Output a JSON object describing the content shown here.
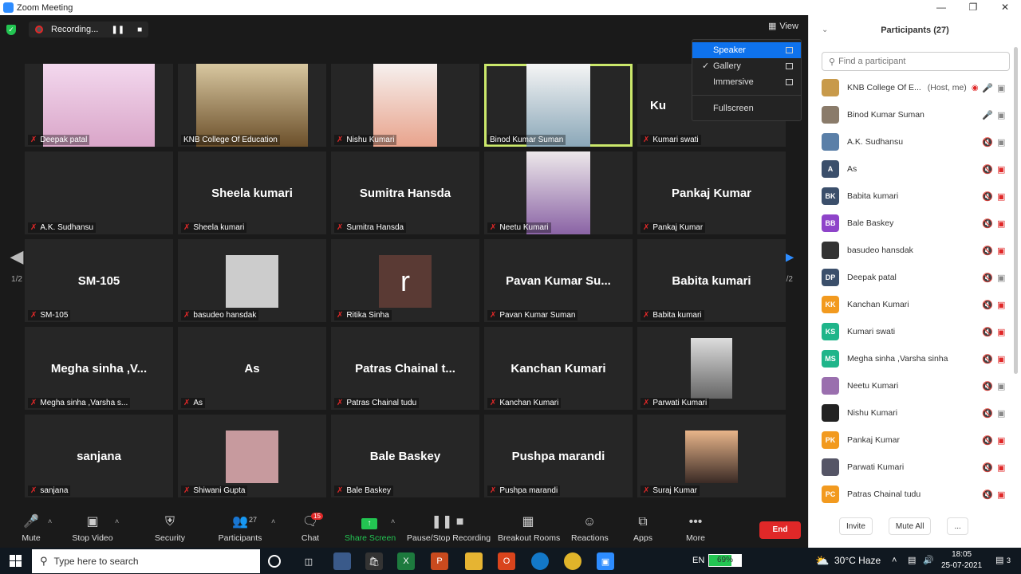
{
  "window": {
    "title": "Zoom Meeting"
  },
  "recording": {
    "label": "Recording..."
  },
  "view_button": {
    "label": "View"
  },
  "view_menu": {
    "items": [
      {
        "label": "Speaker",
        "active": true
      },
      {
        "label": "Gallery",
        "checked": true
      },
      {
        "label": "Immersive"
      },
      {
        "label": "Fullscreen"
      }
    ]
  },
  "gallery": {
    "page_left": "1/2",
    "page_right": "1/2",
    "tiles": [
      {
        "label": "Deepak patal"
      },
      {
        "label": "KNB College Of Education"
      },
      {
        "label": "Nishu Kumari"
      },
      {
        "label": "Binod Kumar Suman",
        "speaking": true
      },
      {
        "label": "Kumari swati",
        "big": "Ku"
      },
      {
        "label": "A.K. Sudhansu"
      },
      {
        "label": "Sheela kumari",
        "big": "Sheela kumari"
      },
      {
        "label": "Sumitra Hansda",
        "big": "Sumitra Hansda"
      },
      {
        "label": "Neetu Kumari"
      },
      {
        "label": "Pankaj Kumar",
        "big": "Pankaj Kumar"
      },
      {
        "label": "SM-105",
        "big": "SM-105"
      },
      {
        "label": "basudeo hansdak"
      },
      {
        "label": "Ritika Sinha",
        "letter": "r"
      },
      {
        "label": "Pavan Kumar Suman",
        "big": "Pavan Kumar Su..."
      },
      {
        "label": "Babita kumari",
        "big": "Babita kumari"
      },
      {
        "label": "Megha sinha ,Varsha s...",
        "big": "Megha sinha ,V..."
      },
      {
        "label": "As",
        "big": "As"
      },
      {
        "label": "Patras Chainal tudu",
        "big": "Patras Chainal t..."
      },
      {
        "label": "Kanchan Kumari",
        "big": "Kanchan Kumari"
      },
      {
        "label": "Parwati Kumari"
      },
      {
        "label": "sanjana",
        "big": "sanjana"
      },
      {
        "label": "Shiwani Gupta"
      },
      {
        "label": "Bale Baskey",
        "big": "Bale Baskey"
      },
      {
        "label": "Pushpa marandi",
        "big": "Pushpa marandi"
      },
      {
        "label": "Suraj Kumar"
      }
    ]
  },
  "toolbar": {
    "mute": "Mute",
    "stop_video": "Stop Video",
    "security": "Security",
    "participants": "Participants",
    "participants_count": "27",
    "chat": "Chat",
    "chat_badge": "15",
    "share_screen": "Share Screen",
    "pause_recording": "Pause/Stop Recording",
    "breakout": "Breakout Rooms",
    "reactions": "Reactions",
    "apps": "Apps",
    "more": "More",
    "end": "End"
  },
  "panel": {
    "title": "Participants (27)",
    "search_placeholder": "Find a participant",
    "participants": [
      {
        "name": "KNB College Of E...",
        "host": "(Host, me)",
        "avatar": "",
        "color": "#c89a4a",
        "mic": "on",
        "cam": "on",
        "rec": true
      },
      {
        "name": "Binod Kumar Suman",
        "avatar": "",
        "color": "#8a7b6a",
        "mic": "on",
        "cam": "on"
      },
      {
        "name": "A.K. Sudhansu",
        "avatar": "",
        "color": "#5a7fa8",
        "mic": "off",
        "cam": "on"
      },
      {
        "name": "As",
        "avatar": "A",
        "color": "#3b4f6b",
        "mic": "off",
        "cam": "off"
      },
      {
        "name": "Babita kumari",
        "avatar": "BK",
        "color": "#3b4f6b",
        "mic": "off",
        "cam": "off"
      },
      {
        "name": "Bale Baskey",
        "avatar": "BB",
        "color": "#8e44c9",
        "mic": "off",
        "cam": "off"
      },
      {
        "name": "basudeo hansdak",
        "avatar": "",
        "color": "#333333",
        "mic": "off",
        "cam": "off"
      },
      {
        "name": "Deepak patal",
        "avatar": "DP",
        "color": "#3b4f6b",
        "mic": "off",
        "cam": "on"
      },
      {
        "name": "Kanchan Kumari",
        "avatar": "KK",
        "color": "#f29a1f",
        "mic": "off",
        "cam": "off"
      },
      {
        "name": "Kumari swati",
        "avatar": "KS",
        "color": "#1fb58a",
        "mic": "off",
        "cam": "off"
      },
      {
        "name": "Megha sinha ,Varsha sinha",
        "avatar": "MS",
        "color": "#1fb58a",
        "mic": "off",
        "cam": "off"
      },
      {
        "name": "Neetu Kumari",
        "avatar": "",
        "color": "#9a6fae",
        "mic": "off",
        "cam": "on"
      },
      {
        "name": "Nishu Kumari",
        "avatar": "",
        "color": "#222222",
        "mic": "off",
        "cam": "on"
      },
      {
        "name": "Pankaj Kumar",
        "avatar": "PK",
        "color": "#f29a1f",
        "mic": "off",
        "cam": "off"
      },
      {
        "name": "Parwati Kumari",
        "avatar": "",
        "color": "#555566",
        "mic": "off",
        "cam": "off"
      },
      {
        "name": "Patras Chainal tudu",
        "avatar": "PC",
        "color": "#f29a1f",
        "mic": "off",
        "cam": "off"
      }
    ],
    "invite": "Invite",
    "mute_all": "Mute All",
    "more": "..."
  },
  "taskbar": {
    "search_placeholder": "Type here to search",
    "lang": "EN",
    "battery": "69%",
    "battery_level": 0.69,
    "weather": "30°C Haze",
    "time": "18:05",
    "date": "25-07-2021",
    "notifications": "3"
  }
}
